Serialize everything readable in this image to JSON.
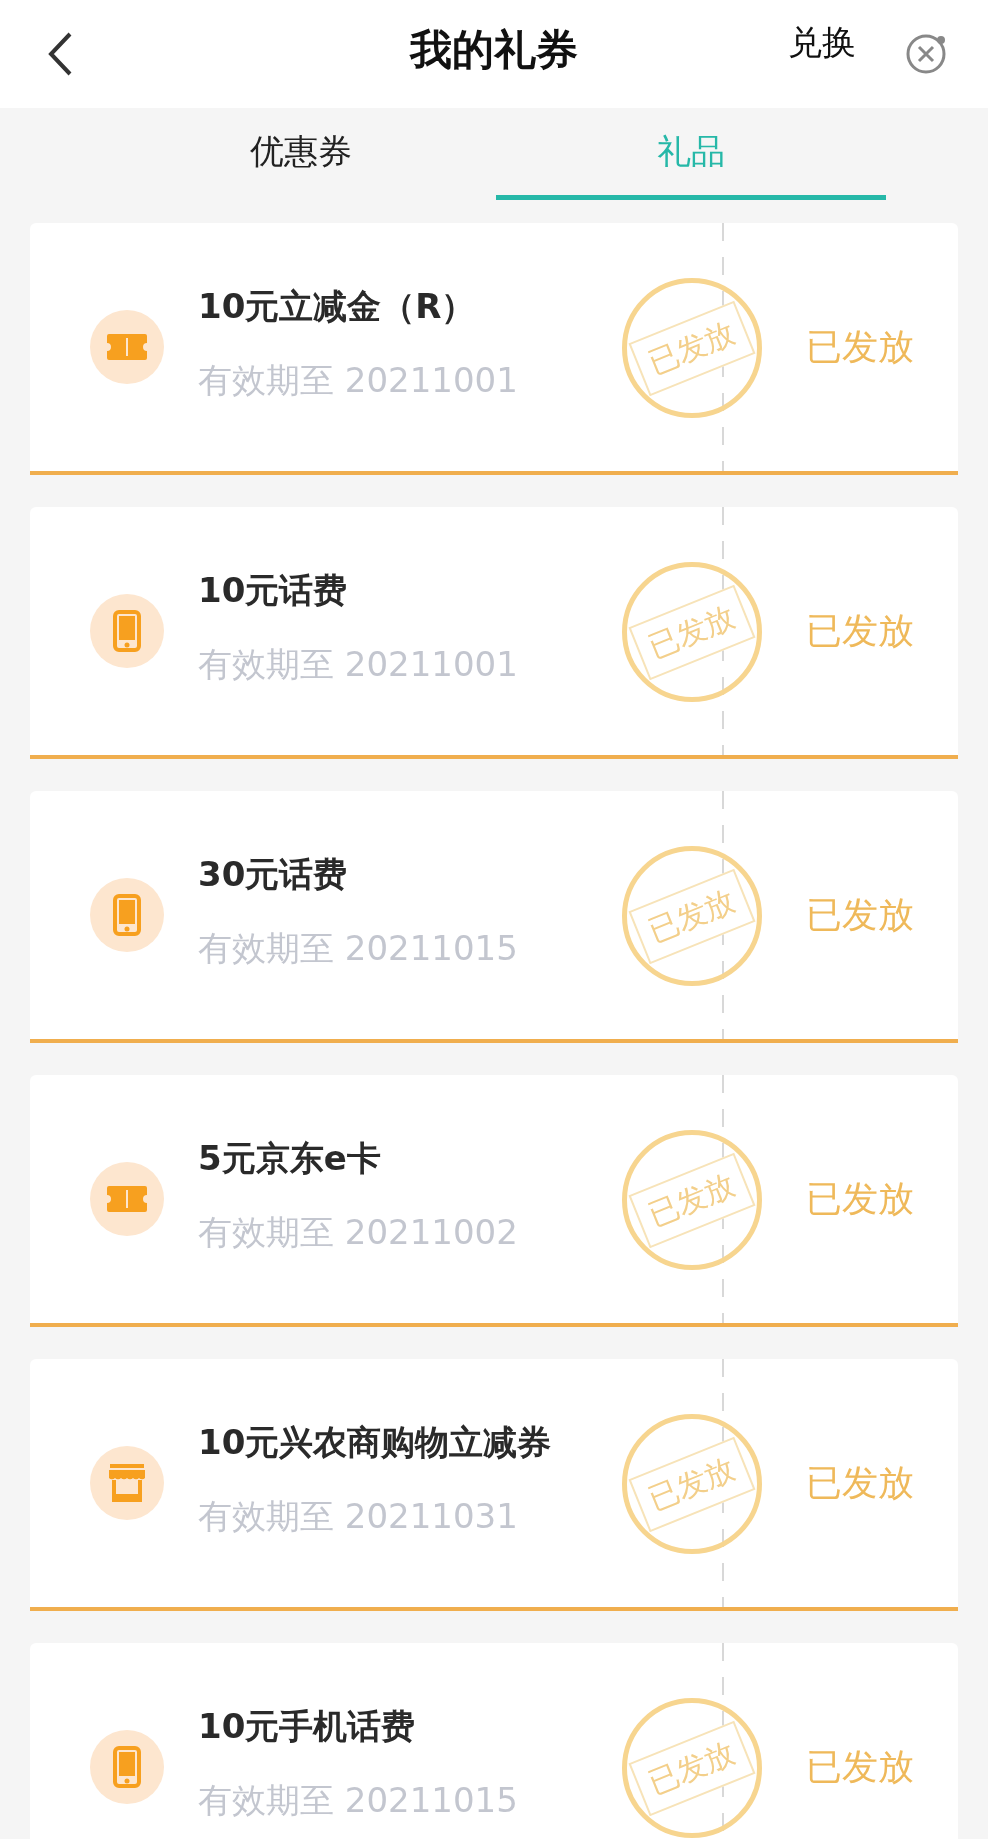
{
  "header": {
    "title": "我的礼券",
    "action": "兑换"
  },
  "tabs": [
    {
      "label": "优惠券",
      "selected": false
    },
    {
      "label": "礼品",
      "selected": true
    }
  ],
  "gifts": [
    {
      "kind": "ticket",
      "title": "10元立减金（R）",
      "expiry": "有效期至 20211001",
      "stamp": "已发放",
      "status": "已发放"
    },
    {
      "kind": "phone",
      "title": "10元话费",
      "expiry": "有效期至 20211001",
      "stamp": "已发放",
      "status": "已发放"
    },
    {
      "kind": "phone",
      "title": "30元话费",
      "expiry": "有效期至 20211015",
      "stamp": "已发放",
      "status": "已发放"
    },
    {
      "kind": "ticket",
      "title": "5元京东e卡",
      "expiry": "有效期至 20211002",
      "stamp": "已发放",
      "status": "已发放"
    },
    {
      "kind": "shop",
      "title": "10元兴农商购物立减券",
      "expiry": "有效期至 20211031",
      "stamp": "已发放",
      "status": "已发放"
    },
    {
      "kind": "phone",
      "title": "10元手机话费",
      "expiry": "有效期至 20211015",
      "stamp": "已发放",
      "status": "已发放"
    }
  ]
}
